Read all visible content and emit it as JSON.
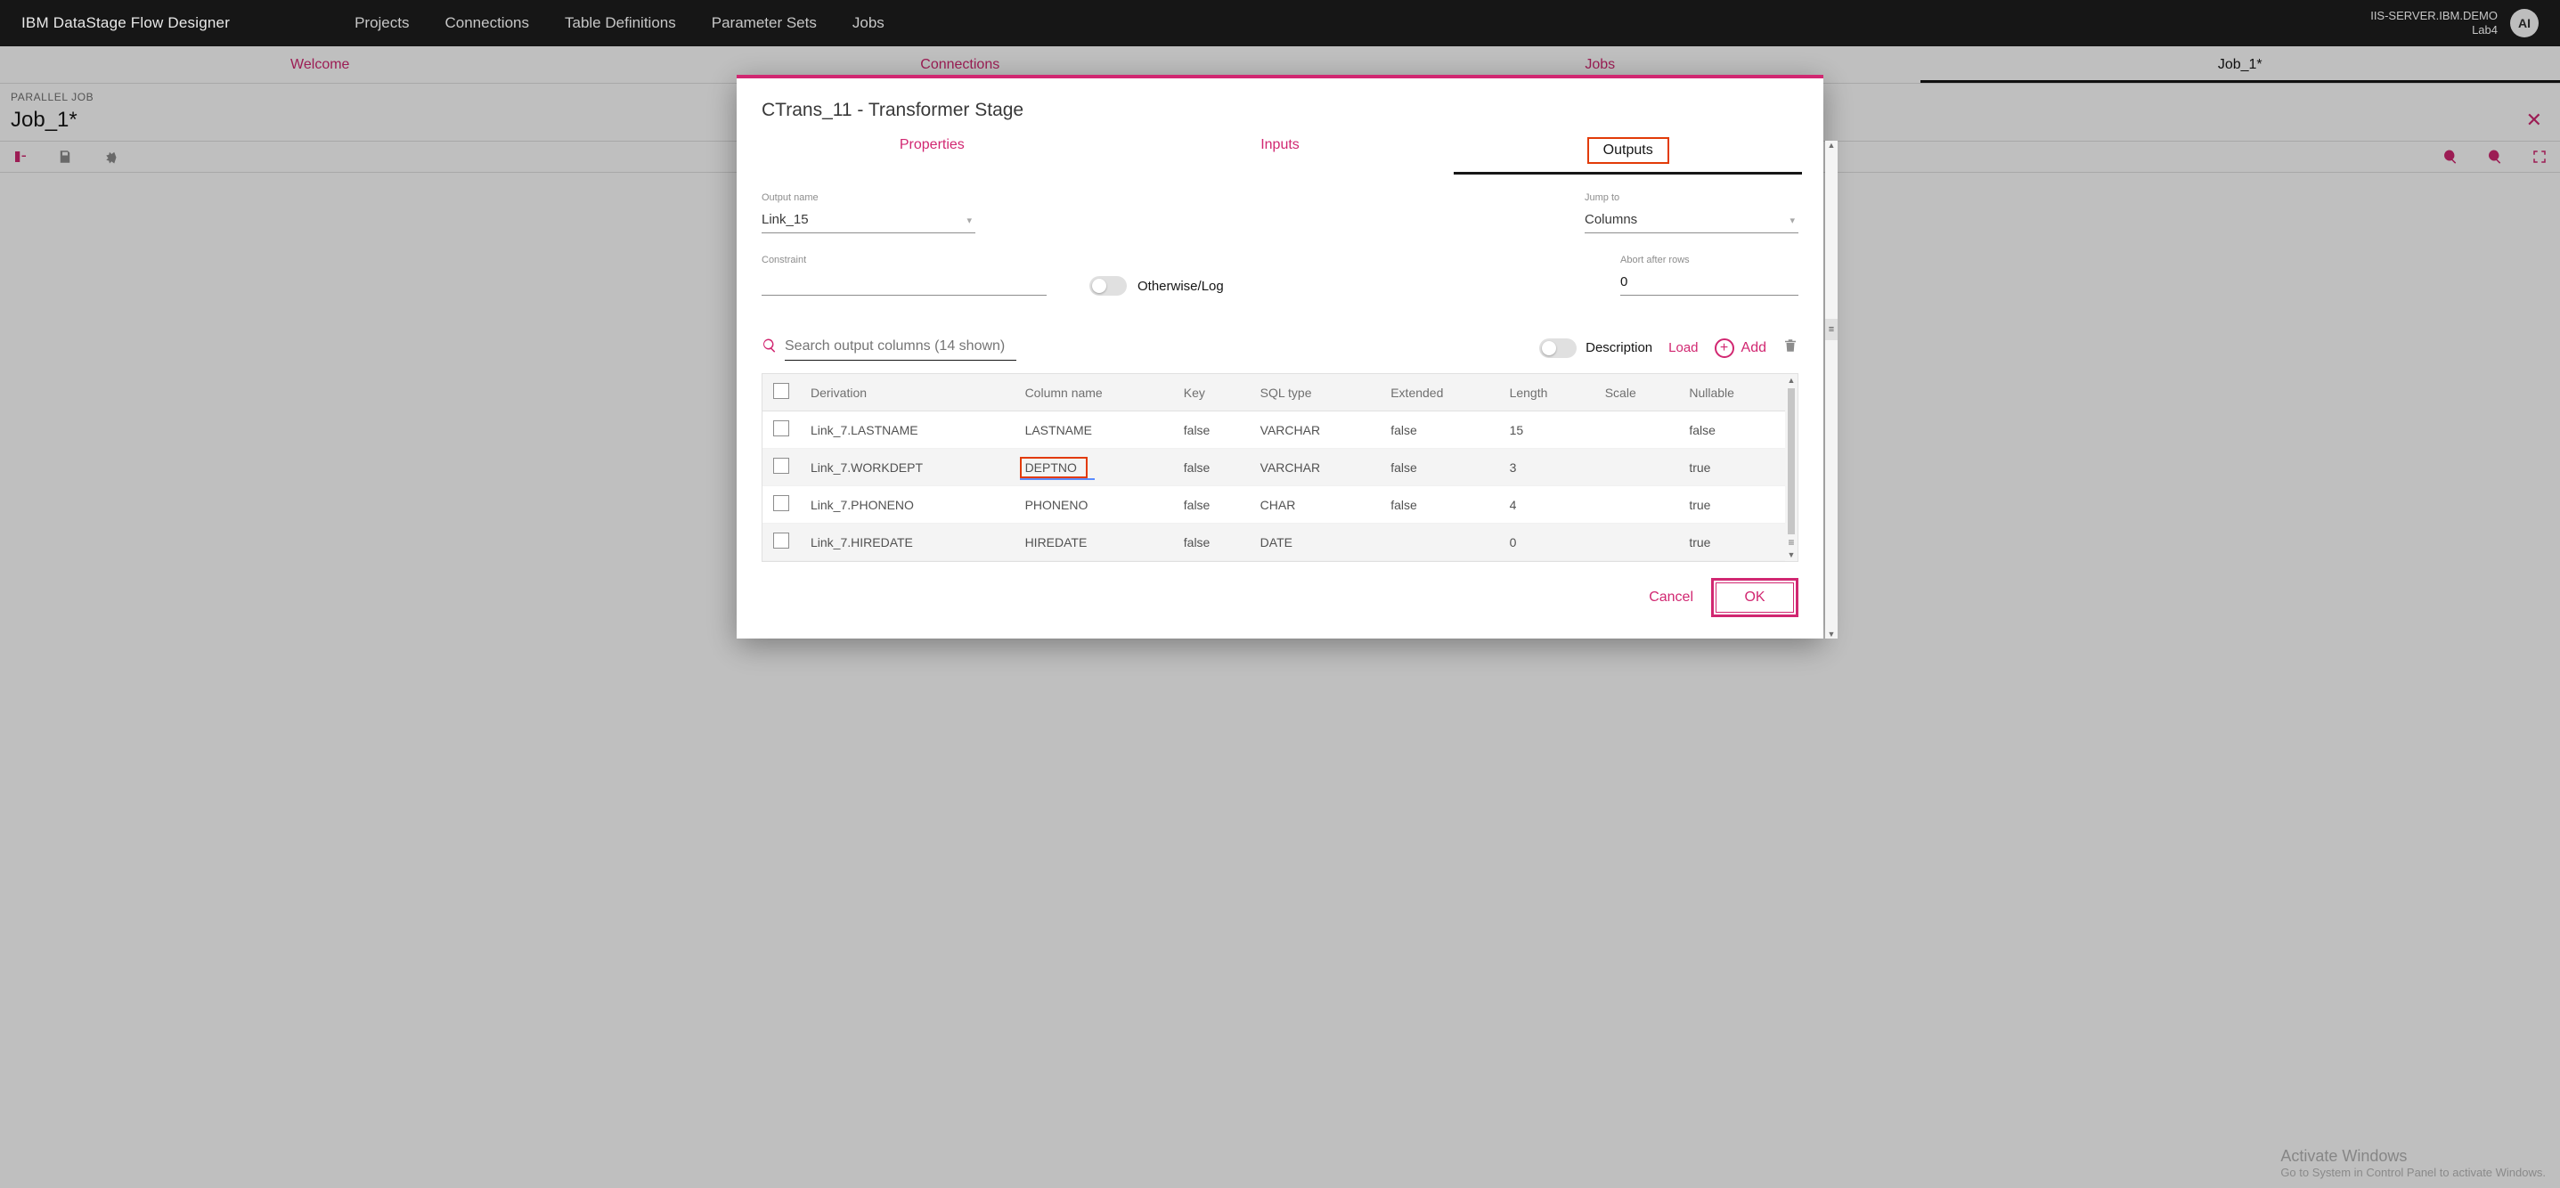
{
  "header": {
    "app_title": "IBM DataStage Flow Designer",
    "nav": {
      "projects": "Projects",
      "connections": "Connections",
      "table_defs": "Table Definitions",
      "param_sets": "Parameter Sets",
      "jobs": "Jobs"
    },
    "server_line1": "IIS-SERVER.IBM.DEMO",
    "server_line2": "Lab4",
    "avatar": "AI"
  },
  "page_tabs": {
    "welcome": "Welcome",
    "connections": "Connections",
    "jobs": "Jobs",
    "job1": "Job_1*"
  },
  "job": {
    "type_label": "PARALLEL JOB",
    "title": "Job_1*"
  },
  "modal": {
    "title": "CTrans_11 - Transformer Stage",
    "tabs": {
      "properties": "Properties",
      "inputs": "Inputs",
      "outputs": "Outputs"
    },
    "output_name_label": "Output name",
    "output_name_value": "Link_15",
    "jump_to_label": "Jump to",
    "jump_to_value": "Columns",
    "constraint_label": "Constraint",
    "constraint_value": "",
    "otherwise_label": "Otherwise/Log",
    "abort_label": "Abort after rows",
    "abort_value": "0",
    "search_placeholder": "Search output columns (14 shown)",
    "description_toggle_label": "Description",
    "load_label": "Load",
    "add_label": "Add",
    "columns": {
      "headers": {
        "derivation": "Derivation",
        "colname": "Column name",
        "key": "Key",
        "sqltype": "SQL type",
        "extended": "Extended",
        "length": "Length",
        "scale": "Scale",
        "nullable": "Nullable"
      },
      "rows": [
        {
          "derivation": "Link_7.LASTNAME",
          "colname": "LASTNAME",
          "key": "false",
          "sqltype": "VARCHAR",
          "extended": "false",
          "length": "15",
          "scale": "",
          "nullable": "false"
        },
        {
          "derivation": "Link_7.WORKDEPT",
          "colname": "DEPTNO",
          "key": "false",
          "sqltype": "VARCHAR",
          "extended": "false",
          "length": "3",
          "scale": "",
          "nullable": "true"
        },
        {
          "derivation": "Link_7.PHONENO",
          "colname": "PHONENO",
          "key": "false",
          "sqltype": "CHAR",
          "extended": "false",
          "length": "4",
          "scale": "",
          "nullable": "true"
        },
        {
          "derivation": "Link_7.HIREDATE",
          "colname": "HIREDATE",
          "key": "false",
          "sqltype": "DATE",
          "extended": "",
          "length": "0",
          "scale": "",
          "nullable": "true"
        }
      ]
    },
    "footer": {
      "cancel": "Cancel",
      "ok": "OK"
    }
  },
  "watermark": {
    "l1": "Activate Windows",
    "l2": "Go to System in Control Panel to activate Windows."
  }
}
